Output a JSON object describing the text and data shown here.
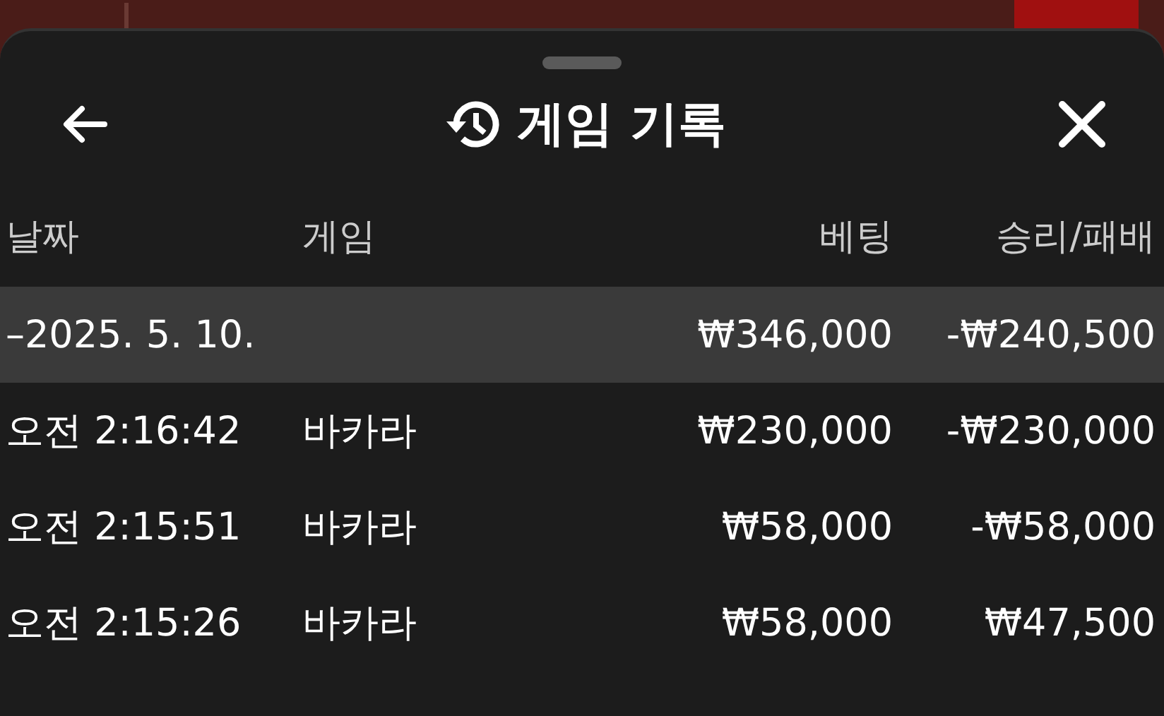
{
  "sheet": {
    "title": "게임 기록"
  },
  "table": {
    "columns": [
      "날짜",
      "게임",
      "베팅",
      "승리/패배"
    ],
    "rows": [
      {
        "kind": "group",
        "date": "–2025. 5. 10.",
        "game": "",
        "bet": "₩346,000",
        "result": "-₩240,500"
      },
      {
        "kind": "entry",
        "date": "오전 2:16:42",
        "game": "바카라",
        "bet": "₩230,000",
        "result": "-₩230,000"
      },
      {
        "kind": "entry",
        "date": "오전 2:15:51",
        "game": "바카라",
        "bet": "₩58,000",
        "result": "-₩58,000"
      },
      {
        "kind": "entry",
        "date": "오전 2:15:26",
        "game": "바카라",
        "bet": "₩58,000",
        "result": "₩47,500"
      }
    ]
  }
}
